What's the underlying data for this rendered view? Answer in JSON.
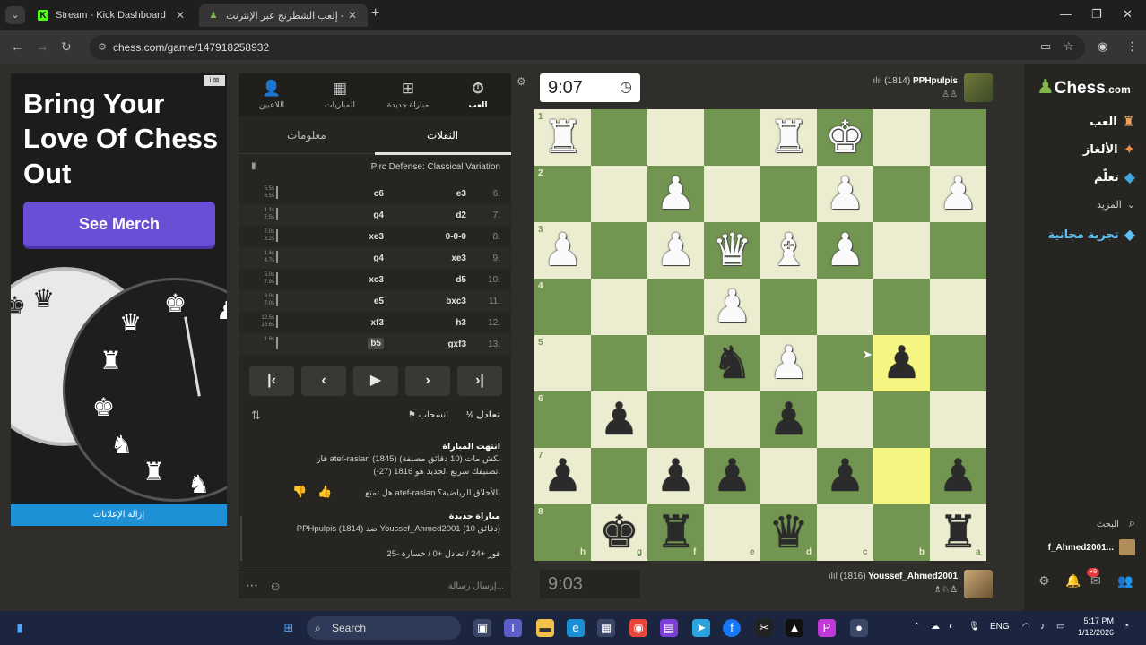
{
  "browser": {
    "tabs": [
      {
        "title": "Stream - Kick Dashboard",
        "favicon": "kick-icon",
        "active": false
      },
      {
        "title": "إلعب الشطرنج عبر الإنترنت - Chess.com",
        "favicon": "chess-pawn-icon",
        "active": true
      }
    ],
    "url": "chess.com/game/147918258932"
  },
  "ad": {
    "badge": "i ⊠",
    "title": "Bring Your Love Of Chess Out",
    "button": "See Merch",
    "remove_ads": "إزالة الإعلانات"
  },
  "panel": {
    "top_tabs": [
      {
        "label": "العب",
        "icon": "stopwatch-icon"
      },
      {
        "label": "مباراة جديدة",
        "icon": "plus-icon"
      },
      {
        "label": "المباريات",
        "icon": "board-icon"
      },
      {
        "label": "اللاعبين",
        "icon": "players-icon"
      }
    ],
    "sub_tabs": [
      "النقلات",
      "معلومات"
    ],
    "opening": "Pirc Defense: Classical Variation",
    "moves": [
      {
        "num": "6.",
        "white": "e3",
        "black": "c6",
        "wt": "5.5s",
        "bt": "6.5s"
      },
      {
        "num": "7.",
        "white": "d2",
        "black": "g4",
        "wt": "1.1s",
        "bt": "7.5s"
      },
      {
        "num": "8.",
        "white": "0-0-0",
        "black": "xe3",
        "wt": "7.0s",
        "bt": "3.2s"
      },
      {
        "num": "9.",
        "white": "xe3",
        "black": "g4",
        "wt": "1.4s",
        "bt": "4.7s"
      },
      {
        "num": "10.",
        "white": "d5",
        "black": "xc3",
        "wt": "5.0s",
        "bt": "7.9s"
      },
      {
        "num": "11.",
        "white": "bxc3",
        "black": "e5",
        "wt": "8.0s",
        "bt": "7.0s"
      },
      {
        "num": "12.",
        "white": "h3",
        "black": "xf3",
        "wt": "12.5s",
        "bt": "16.6s"
      },
      {
        "num": "13.",
        "white": "gxf3",
        "black": "b5",
        "wt": "1.8s",
        "bt": ""
      }
    ],
    "controls": [
      "first-icon",
      "prev-icon",
      "play-icon",
      "next-icon",
      "last-icon"
    ],
    "draw": "½ تعادل",
    "resign": "⚑ انسحاب",
    "chat": {
      "game_over_title": "انتهت المباراة",
      "game_over_text": "فاز atef-raslan (1845) بكش مات (10 دقائق مصنفة)",
      "rating_text": "تصنيفك سريع الجديد هو 1816 (27-).",
      "sportsmanship": "هل تمتع atef-raslan بالأخلاق الرياضية؟",
      "new_game_title": "مباراة جديدة",
      "new_game_text": "PPHpulpis (1814) ضد Youssef_Ahmed2001 (10 دقائق)",
      "odds": "فوز +24 / تعادل +0 / خسارة -25"
    },
    "chat_placeholder": "إرسال رسالة..."
  },
  "game": {
    "top_clock": "9:07",
    "bottom_clock": "9:03",
    "top_player": {
      "name": "PPHpulpis",
      "rating": "(1814)"
    },
    "bottom_player": {
      "name": "Youssef_Ahmed2001",
      "rating": "(1816)"
    },
    "ranks": [
      "1",
      "2",
      "3",
      "4",
      "5",
      "6",
      "7",
      "8"
    ],
    "files": [
      "h",
      "g",
      "f",
      "e",
      "d",
      "c",
      "b",
      "a"
    ],
    "board_rows": [
      [
        "R",
        "",
        "",
        "",
        "R",
        "K",
        "",
        ""
      ],
      [
        "",
        "",
        "P",
        "",
        "",
        "P",
        "",
        "P"
      ],
      [
        "P",
        "",
        "P",
        "Q",
        "B",
        "P",
        "",
        ""
      ],
      [
        "",
        "",
        "",
        "P",
        "",
        "",
        "",
        ""
      ],
      [
        "",
        "",
        "",
        "n",
        "P",
        "",
        "p",
        ""
      ],
      [
        "",
        "p",
        "",
        "",
        "p",
        "",
        "",
        ""
      ],
      [
        "p",
        "",
        "p",
        "p",
        "",
        "p",
        "",
        "p"
      ],
      [
        "",
        "k",
        "r",
        "",
        "q",
        "",
        "",
        "r"
      ]
    ],
    "highlights": [
      [
        4,
        6
      ],
      [
        6,
        6
      ]
    ]
  },
  "sidebar": {
    "logo": "Chess",
    "logo_suffix": ".com",
    "nav": [
      {
        "label": "العب",
        "icon": "play-hand-icon"
      },
      {
        "label": "الألغاز",
        "icon": "puzzle-icon"
      },
      {
        "label": "تعلّم",
        "icon": "learn-cap-icon"
      },
      {
        "label": "المزيد",
        "icon": "chevron-down-icon"
      },
      {
        "label": "تجربة مجانية",
        "icon": "diamond-icon"
      }
    ],
    "search": "البحث",
    "username": "f_Ahmed2001...",
    "notif_count": "+9"
  },
  "taskbar": {
    "search": "Search",
    "lang": "ENG",
    "time": "5:17 PM",
    "date": "1/12/2026"
  },
  "colors": {
    "board_light": "#ebecd0",
    "board_dark": "#739552",
    "highlight": "#f5f682",
    "merch_button": "#6a4fd6",
    "brand_green": "#81b64c"
  }
}
